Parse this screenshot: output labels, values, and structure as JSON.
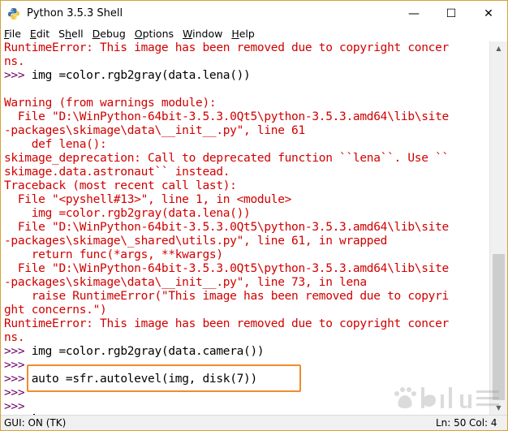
{
  "window": {
    "title": "Python 3.5.3 Shell",
    "controls": {
      "minimize": "—",
      "maximize": "☐",
      "close": "✕"
    }
  },
  "menu": [
    "File",
    "Edit",
    "Shell",
    "Debug",
    "Options",
    "Window",
    "Help"
  ],
  "menu_underline_index": [
    0,
    0,
    1,
    0,
    0,
    0,
    0
  ],
  "console": {
    "prompt": ">>> ",
    "lines": [
      {
        "style": "red",
        "text": "RuntimeError: This image has been removed due to copyright concer"
      },
      {
        "style": "red",
        "text": "ns."
      },
      {
        "style": "prompt",
        "text": "img =color.rgb2gray(data.lena())"
      },
      {
        "style": "black",
        "text": ""
      },
      {
        "style": "red",
        "text": "Warning (from warnings module):"
      },
      {
        "style": "red",
        "text": "  File \"D:\\WinPython-64bit-3.5.3.0Qt5\\python-3.5.3.amd64\\lib\\site"
      },
      {
        "style": "red",
        "text": "-packages\\skimage\\data\\__init__.py\", line 61"
      },
      {
        "style": "red",
        "text": "    def lena():"
      },
      {
        "style": "red",
        "text": "skimage_deprecation: Call to deprecated function ``lena``. Use ``"
      },
      {
        "style": "red",
        "text": "skimage.data.astronaut`` instead."
      },
      {
        "style": "red",
        "text": "Traceback (most recent call last):"
      },
      {
        "style": "red",
        "text": "  File \"<pyshell#13>\", line 1, in <module>"
      },
      {
        "style": "red",
        "text": "    img =color.rgb2gray(data.lena())"
      },
      {
        "style": "red",
        "text": "  File \"D:\\WinPython-64bit-3.5.3.0Qt5\\python-3.5.3.amd64\\lib\\site"
      },
      {
        "style": "red",
        "text": "-packages\\skimage\\_shared\\utils.py\", line 61, in wrapped"
      },
      {
        "style": "red",
        "text": "    return func(*args, **kwargs)"
      },
      {
        "style": "red",
        "text": "  File \"D:\\WinPython-64bit-3.5.3.0Qt5\\python-3.5.3.amd64\\lib\\site"
      },
      {
        "style": "red",
        "text": "-packages\\skimage\\data\\__init__.py\", line 73, in lena"
      },
      {
        "style": "red",
        "text": "    raise RuntimeError(\"This image has been removed due to copyri"
      },
      {
        "style": "red",
        "text": "ght concerns.\")"
      },
      {
        "style": "red",
        "text": "RuntimeError: This image has been removed due to copyright concer"
      },
      {
        "style": "red",
        "text": "ns."
      },
      {
        "style": "prompt",
        "text": "img =color.rgb2gray(data.camera())"
      },
      {
        "style": "prompt",
        "text": ""
      },
      {
        "style": "prompt",
        "text": "auto =sfr.autolevel(img, disk(7))"
      },
      {
        "style": "prompt",
        "text": ""
      },
      {
        "style": "prompt",
        "text": ""
      },
      {
        "style": "prompt-cursor",
        "text": ""
      }
    ]
  },
  "status": {
    "left": "GUI: ON (TK)",
    "ln": "Ln: 50",
    "col": "Col: 4"
  },
  "colors": {
    "error_text": "#d10000",
    "prompt": "#6b0066",
    "highlight_box": "#f08c2d"
  }
}
